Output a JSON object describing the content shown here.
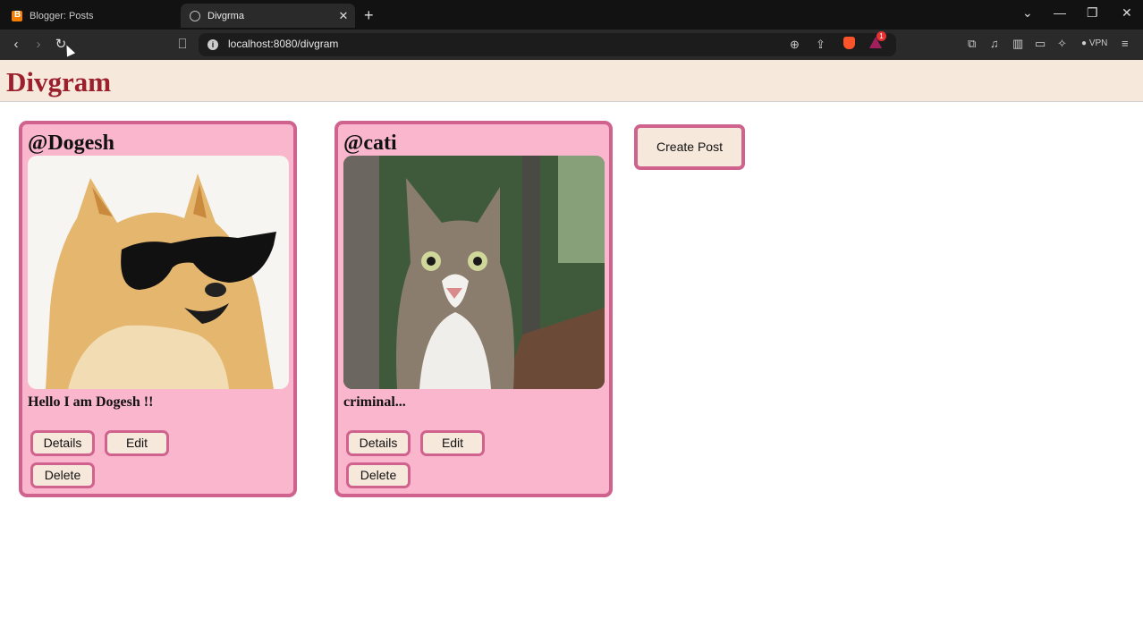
{
  "browser": {
    "tabs": [
      {
        "title": "Blogger: Posts",
        "active": false
      },
      {
        "title": "Divgrma",
        "active": true
      }
    ],
    "new_tab_icon": "+",
    "url": "localhost:8080/divgram",
    "vpn_label": "VPN",
    "rewards_badge": "1",
    "colors": {
      "tabbar": "#121212",
      "toolbar": "#2a2a2a",
      "brave": "#fb542b"
    }
  },
  "app": {
    "title": "Divgram",
    "colors": {
      "title": "#9b1f2d",
      "header_bg": "#f6e8da",
      "card_bg": "#f9b6cd",
      "card_border": "#d0628e"
    }
  },
  "posts": [
    {
      "username": "@Dogesh",
      "caption": "Hello I am Dogesh !!",
      "image": "shiba-inu-dog-with-sunglasses"
    },
    {
      "username": "@cati",
      "caption": "criminal...",
      "image": "tabby-cat-outdoors"
    }
  ],
  "post_actions": {
    "details": "Details",
    "edit": "Edit",
    "delete": "Delete"
  },
  "create_post_label": "Create Post"
}
